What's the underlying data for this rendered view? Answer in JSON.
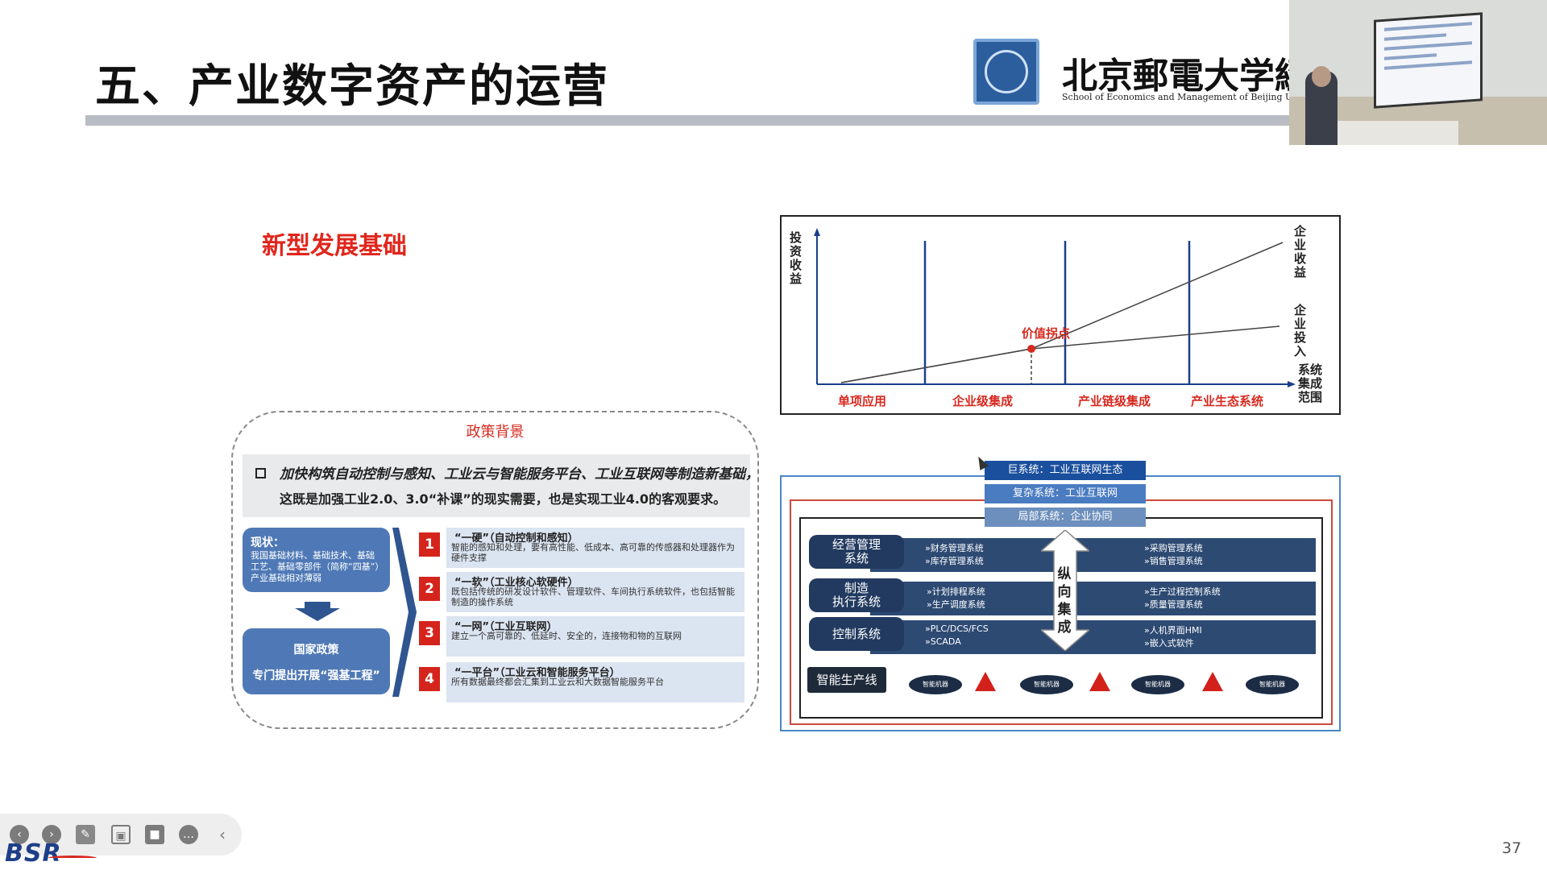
{
  "slide": {
    "title": "五、产业数字资产的运营",
    "subheading": "新型发展基础",
    "page_number": "37"
  },
  "logo": {
    "university_cn": "北京郵電大学經濟",
    "university_en": "School of Economics and Management of Beijing University"
  },
  "policy": {
    "title": "政策背景",
    "banner_line1": "加快构筑自动控制与感知、工业云与智能服务平台、工业互联网等制造新基础，",
    "banner_line2": "这既是加强工业2.0、3.0“补课”的现实需要，也是实现工业4.0的客观要求。",
    "status_heading": "现状：",
    "status_body": "我国基础材料、基础技术、基础工艺、基础零部件（简称“四基”）产业基础相对薄弱",
    "gov_line1": "国家政策",
    "gov_line2": "专门提出开展“强基工程”",
    "items": [
      {
        "num": "1",
        "title": "“一硬”（自动控制和感知）",
        "desc": "智能的感知和处理，要有高性能、低成本、高可靠的传感器和处理器作为硬件支撑"
      },
      {
        "num": "2",
        "title": "“一软”（工业核心软硬件）",
        "desc": "既包括传统的研发设计软件、管理软件、车间执行系统软件，也包括智能制造的操作系统"
      },
      {
        "num": "3",
        "title": "“一网”（工业互联网）",
        "desc": "建立一个高可靠的、低延时、安全的，连接物和物的互联网"
      },
      {
        "num": "4",
        "title": "“一平台”（工业云和智能服务平台）",
        "desc": "所有数据最终都会汇集到工业云和大数据智能服务平台"
      }
    ]
  },
  "chart_data": {
    "type": "line",
    "title": "",
    "ylabel": "投资收益",
    "xlabel": "系统集成范围",
    "categories": [
      "单项应用",
      "企业级集成",
      "产业链级集成",
      "产业生态系统"
    ],
    "series": [
      {
        "name": "企业收益"
      },
      {
        "name": "企业投入"
      }
    ],
    "annotation": "价值拐点",
    "colors": {
      "labels": "#d6291f",
      "lines": "#333333"
    }
  },
  "integration": {
    "level_top": "巨系统：工业互联网生态",
    "level_mid": "复杂系统：工业互联网",
    "level_low": "局部系统：企业协同",
    "vertical_label": "纵向集成",
    "rows": [
      {
        "label": "经营管理\n系统",
        "left": [
          "»财务管理系统",
          "»库存管理系统"
        ],
        "right": [
          "»采购管理系统",
          "»销售管理系统"
        ]
      },
      {
        "label": "制造\n执行系统",
        "left": [
          "»计划排程系统",
          "»生产调度系统"
        ],
        "right": [
          "»生产过程控制系统",
          "»质量管理系统"
        ]
      },
      {
        "label": "控制系统",
        "left": [
          "»PLC/DCS/FCS",
          "»SCADA"
        ],
        "right": [
          "»人机界面HMI",
          "»嵌入式软件"
        ]
      }
    ],
    "line_label": "智能生产线",
    "robot_label": "智能机器"
  },
  "toolbar": {
    "brand": "BSR",
    "icons": [
      "prev-icon",
      "next-icon",
      "pen-icon",
      "screenshot-icon",
      "camera-icon",
      "more-icon",
      "collapse-icon"
    ]
  }
}
